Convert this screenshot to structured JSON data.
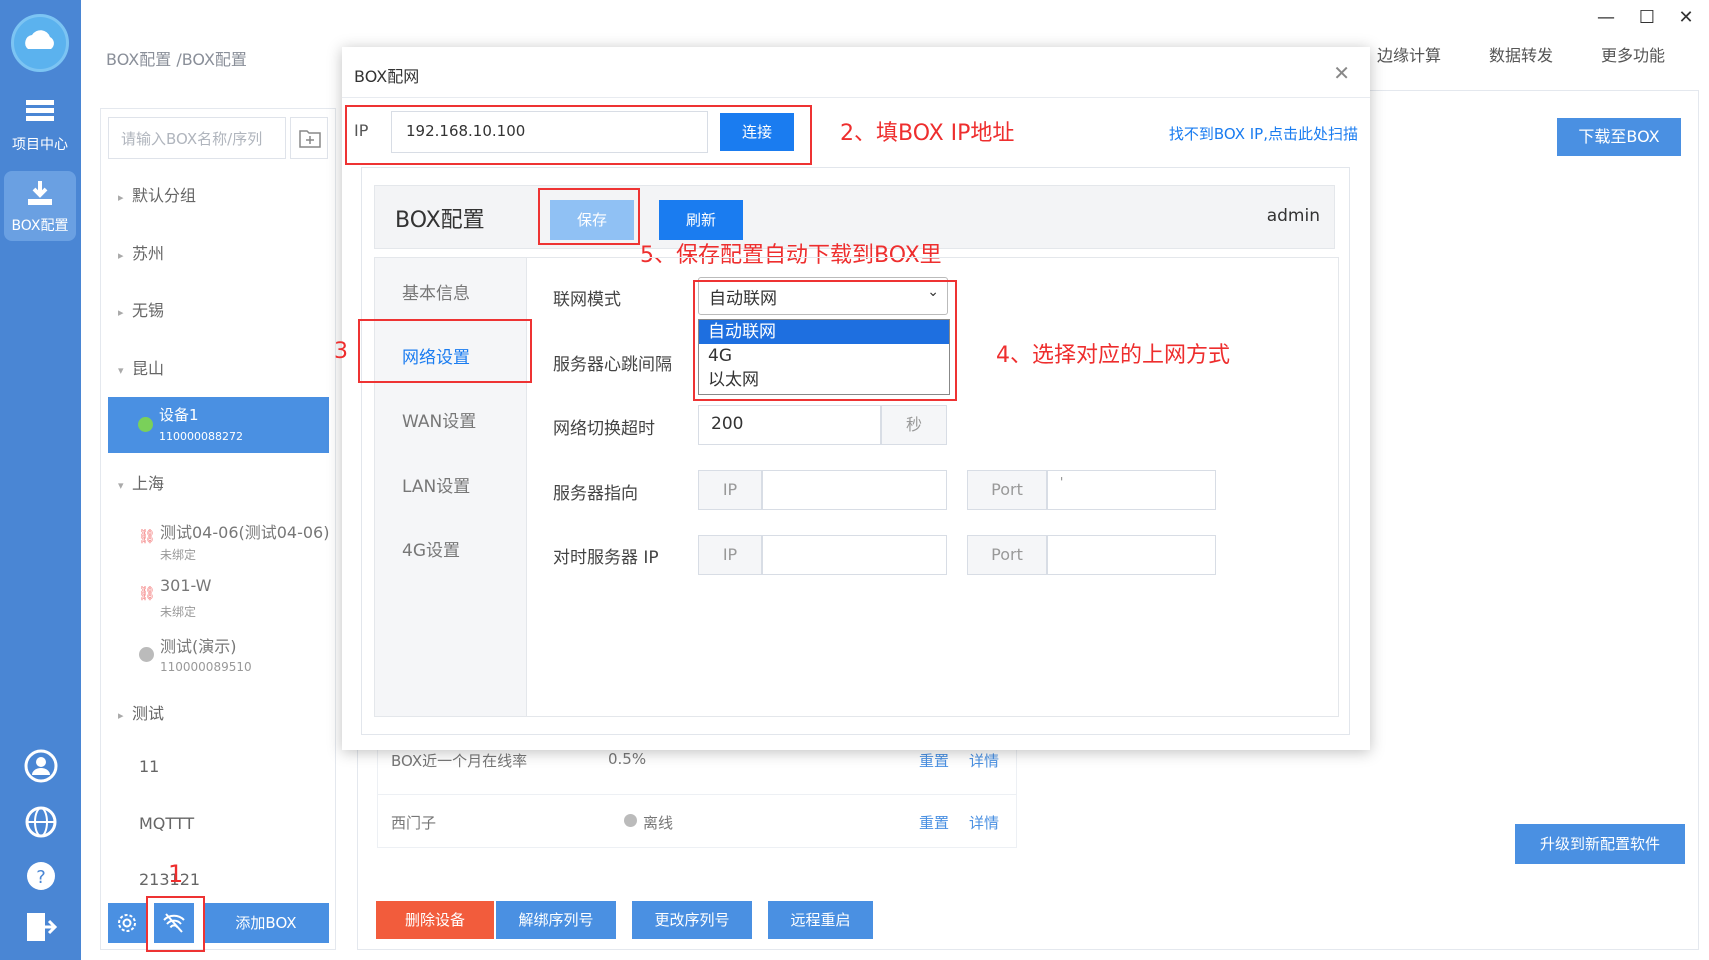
{
  "window_controls": {
    "minimize": "—",
    "maximize": "☐",
    "close": "✕"
  },
  "rail": {
    "items": [
      {
        "label": "项目中心",
        "icon": "list-icon"
      },
      {
        "label": "BOX配置",
        "icon": "download-icon"
      }
    ],
    "bottom_icons": [
      "user-icon",
      "globe-icon",
      "help-icon",
      "exit-icon"
    ]
  },
  "breadcrumb": "BOX配置 /BOX配置",
  "topnav": [
    "边缘计算",
    "数据转发",
    "更多功能"
  ],
  "search": {
    "placeholder": "请输入BOX名称/序列"
  },
  "tree": {
    "group_default": "默认分组",
    "group_suzhou": "苏州",
    "group_wuxi": "无锡",
    "group_kunshan": "昆山",
    "device1": {
      "name": "设备1",
      "sn": "110000088272"
    },
    "group_shanghai": "上海",
    "dev_test0406": {
      "name": "测试04-06(测试04-06)",
      "status": "未绑定"
    },
    "dev_301w": {
      "name": "301-W",
      "status": "未绑定"
    },
    "dev_demo": {
      "name": "测试(演示)",
      "sn": "110000089510"
    },
    "group_test": "测试",
    "item_11": "11",
    "item_mqttt": "MQTTT",
    "item_213121": "213121"
  },
  "bottom_bar": {
    "add_box": "添加BOX"
  },
  "right": {
    "download_btn": "下载至BOX",
    "upgrade_btn": "升级到新配置软件",
    "actions": [
      "删除设备",
      "解绑序列号",
      "更改序列号",
      "远程重启"
    ],
    "rows": [
      {
        "label": "BOX近一个月在线率",
        "value": "0.5%",
        "reset": "重置",
        "detail": "详情"
      },
      {
        "label": "西门子",
        "value": "离线",
        "reset": "重置",
        "detail": "详情"
      }
    ]
  },
  "dialog": {
    "title": "BOX配网",
    "ip_label": "IP",
    "ip_value": "192.168.10.100",
    "connect_btn": "连接",
    "scan_link": "找不到BOX IP,点击此处扫描",
    "config_title": "BOX配置",
    "save_btn": "保存",
    "refresh_btn": "刷新",
    "user": "admin",
    "tabs": [
      "基本信息",
      "网络设置",
      "WAN设置",
      "LAN设置",
      "4G设置"
    ],
    "form": {
      "net_mode_label": "联网模式",
      "net_mode_value": "自动联网",
      "options": [
        "自动联网",
        "4G",
        "以太网"
      ],
      "heartbeat_label": "服务器心跳间隔",
      "switch_timeout_label": "网络切换超时",
      "switch_timeout_value": "200",
      "unit_sec": "秒",
      "server_label": "服务器指向",
      "time_server_label": "对时服务器 IP",
      "ip_addon": "IP",
      "port_addon": "Port",
      "server_port_value": "'"
    }
  },
  "annotations": {
    "a1": "1",
    "a2": "2、填BOX IP地址",
    "a3": "3",
    "a4": "4、选择对应的上网方式",
    "a5": "5、保存配置自动下载到BOX里"
  },
  "colors": {
    "rail": "#4a86d4",
    "primary": "#1a7cf0",
    "danger": "#f25c3c",
    "annotation": "#ee2e2e"
  }
}
